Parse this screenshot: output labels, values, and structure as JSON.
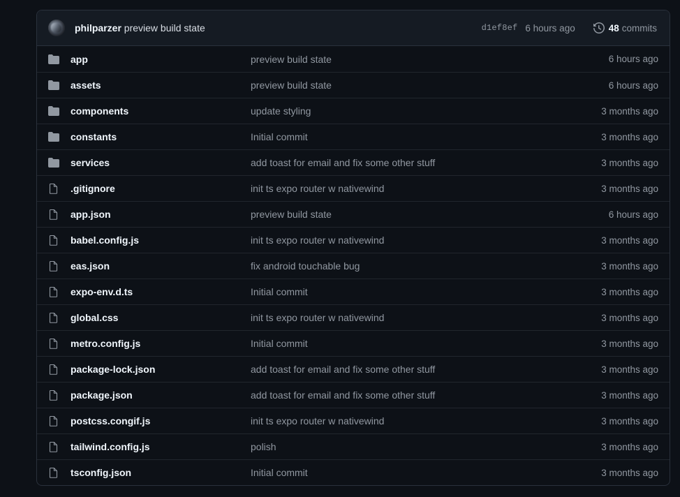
{
  "colors": {
    "page_background": "#0d1117",
    "panel_header_background": "#151b23",
    "panel_border": "#2a313c",
    "row_divider": "#21262d",
    "text_primary": "#f0f6fc",
    "text_muted": "#9198a1"
  },
  "header": {
    "avatar_alt": "philparzer avatar",
    "author": "philparzer",
    "commit_message": "preview build state",
    "commit_hash": "d1ef8ef",
    "relative_time": "6 hours ago",
    "history_icon": "history-icon",
    "commits_count": "48",
    "commits_label": "commits"
  },
  "files": [
    {
      "icon": "folder-icon",
      "type": "folder",
      "name": "app",
      "message": "preview build state",
      "time": "6 hours ago"
    },
    {
      "icon": "folder-icon",
      "type": "folder",
      "name": "assets",
      "message": "preview build state",
      "time": "6 hours ago"
    },
    {
      "icon": "folder-icon",
      "type": "folder",
      "name": "components",
      "message": "update styling",
      "time": "3 months ago"
    },
    {
      "icon": "folder-icon",
      "type": "folder",
      "name": "constants",
      "message": "Initial commit",
      "time": "3 months ago"
    },
    {
      "icon": "folder-icon",
      "type": "folder",
      "name": "services",
      "message": "add toast for email and fix some other stuff",
      "time": "3 months ago"
    },
    {
      "icon": "file-icon",
      "type": "file",
      "name": ".gitignore",
      "message": "init ts expo router w nativewind",
      "time": "3 months ago"
    },
    {
      "icon": "file-icon",
      "type": "file",
      "name": "app.json",
      "message": "preview build state",
      "time": "6 hours ago"
    },
    {
      "icon": "file-icon",
      "type": "file",
      "name": "babel.config.js",
      "message": "init ts expo router w nativewind",
      "time": "3 months ago"
    },
    {
      "icon": "file-icon",
      "type": "file",
      "name": "eas.json",
      "message": "fix android touchable bug",
      "time": "3 months ago"
    },
    {
      "icon": "file-icon",
      "type": "file",
      "name": "expo-env.d.ts",
      "message": "Initial commit",
      "time": "3 months ago"
    },
    {
      "icon": "file-icon",
      "type": "file",
      "name": "global.css",
      "message": "init ts expo router w nativewind",
      "time": "3 months ago"
    },
    {
      "icon": "file-icon",
      "type": "file",
      "name": "metro.config.js",
      "message": "Initial commit",
      "time": "3 months ago"
    },
    {
      "icon": "file-icon",
      "type": "file",
      "name": "package-lock.json",
      "message": "add toast for email and fix some other stuff",
      "time": "3 months ago"
    },
    {
      "icon": "file-icon",
      "type": "file",
      "name": "package.json",
      "message": "add toast for email and fix some other stuff",
      "time": "3 months ago"
    },
    {
      "icon": "file-icon",
      "type": "file",
      "name": "postcss.congif.js",
      "message": "init ts expo router w nativewind",
      "time": "3 months ago"
    },
    {
      "icon": "file-icon",
      "type": "file",
      "name": "tailwind.config.js",
      "message": "polish",
      "time": "3 months ago"
    },
    {
      "icon": "file-icon",
      "type": "file",
      "name": "tsconfig.json",
      "message": "Initial commit",
      "time": "3 months ago"
    }
  ]
}
